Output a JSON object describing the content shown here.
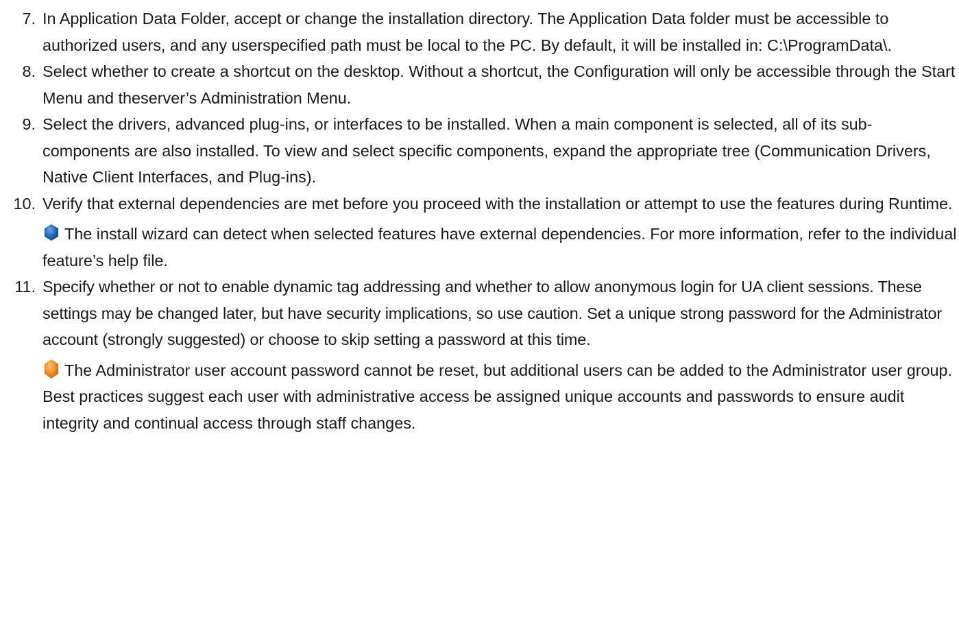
{
  "steps": [
    {
      "number": "7.",
      "text": "In Application Data Folder, accept or change the installation directory. The Application Data folder must be accessible to authorized users, and any userspecified path must be local to the PC. By default, it will be installed in: C:\\ProgramData\\."
    },
    {
      "number": "8.",
      "text": "Select whether to create a shortcut on the desktop.  Without a shortcut, the Configuration will only be accessible through the Start Menu and theserver’s Administration Menu."
    },
    {
      "number": "9.",
      "text": "Select the drivers, advanced plug-ins, or interfaces to be installed. When a main component is selected, all of its sub-components are also installed. To view and select specific components, expand the appropriate tree (Communication Drivers, Native Client Interfaces, and Plug-ins)."
    },
    {
      "number": "10.",
      "text": "Verify that external dependencies are met before you proceed with the installation or attempt to use the features during Runtime.",
      "note": {
        "icon": "info-hexagon-icon",
        "color": "#1f63b5",
        "text": "The install wizard can detect when selected features have external dependencies. For more information, refer to the individual feature’s help file."
      }
    },
    {
      "number": "11.",
      "text": "Specify whether or not to enable dynamic tag addressing and whether to allow anonymous login for UA client sessions. These settings may be changed later, but have security implications, so use caution. Set a unique strong password for the Administrator account (strongly suggested) or choose to skip setting a password at this time.",
      "note": {
        "icon": "warning-hexagon-icon",
        "color": "#f08a1c",
        "text": "The Administrator user account password cannot be reset, but additional users can be added to the Administrator user group. Best practices suggest each user with administrative access be assigned unique accounts and passwords to ensure audit integrity and continual access through staff changes."
      }
    }
  ]
}
